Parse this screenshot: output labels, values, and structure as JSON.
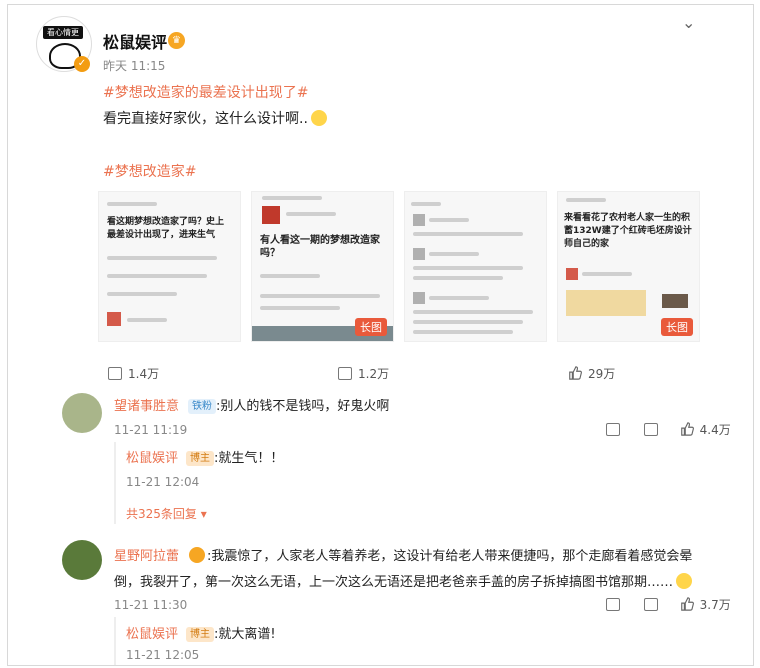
{
  "post": {
    "author": "松鼠娱评",
    "time": "昨天 11:15",
    "topic1": "#梦想改造家的最差设计出现了#",
    "text": "看完直接好家伙，这什么设计啊..",
    "topic2": "#梦想改造家#",
    "avatar_tag": "看心情更"
  },
  "thumbs": [
    {
      "heading": "看这期梦想改造家了吗？史上最差设计出现了，进来生气",
      "pill": ""
    },
    {
      "heading": "有人看这一期的梦想改造家吗？",
      "pill": "长图"
    },
    {
      "heading": "",
      "pill": ""
    },
    {
      "heading": "来看看花了农村老人家一生的积蓄132W建了个红砖毛坯房设计师自己的家",
      "pill": "长图"
    }
  ],
  "actions": {
    "share": "1.4万",
    "comment": "1.2万",
    "like": "29万"
  },
  "comments": [
    {
      "name": "望诸事胜意",
      "badge": "铁粉",
      "text": ":别人的钱不是钱吗，好鬼火啊",
      "time": "11-21 11:19",
      "likes": "4.4万",
      "reply": {
        "name": "松鼠娱评",
        "badge": "博主",
        "text": ":就生气！！",
        "time": "11-21 12:04"
      },
      "more": "共325条回复"
    },
    {
      "name": "星野阿拉蕾",
      "text_l1": ":我震惊了，人家老人等着养老，这设计有给老人带来便捷吗，那个走廊看着感觉会晕",
      "text_l2": "倒，我裂开了，第一次这么无语，上一次这么无语还是把老爸亲手盖的房子拆掉搞图书馆那期……",
      "time": "11-21 11:30",
      "likes": "3.7万",
      "reply": {
        "name": "松鼠娱评",
        "badge": "博主",
        "text": ":就大离谱!",
        "time": "11-21 12:05"
      }
    }
  ]
}
